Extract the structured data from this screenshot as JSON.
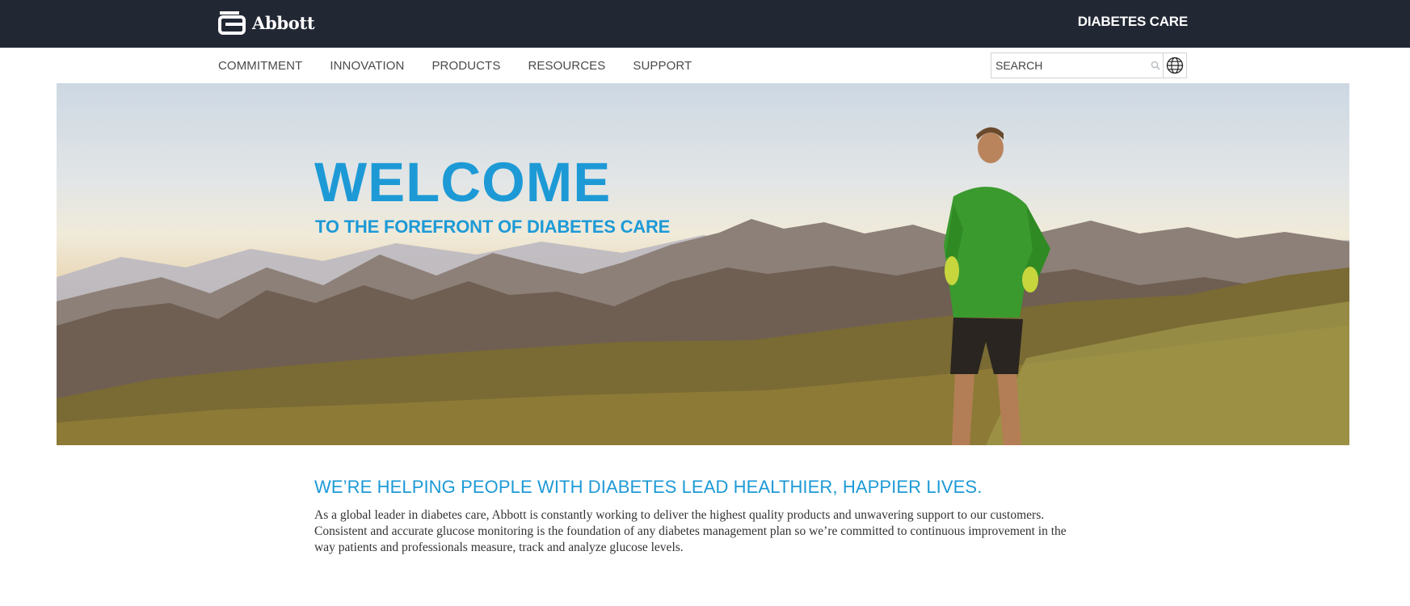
{
  "header": {
    "logo_text": "Abbott",
    "brand_title": "DIABETES CARE"
  },
  "nav": {
    "items": [
      "COMMITMENT",
      "INNOVATION",
      "PRODUCTS",
      "RESOURCES",
      "SUPPORT"
    ]
  },
  "search": {
    "placeholder": "SEARCH",
    "icon": "search-icon"
  },
  "language": {
    "icon": "globe-icon"
  },
  "hero": {
    "title": "WELCOME",
    "subtitle": "TO THE FOREFRONT OF DIABETES CARE"
  },
  "intro": {
    "heading": "WE’RE HELPING PEOPLE WITH DIABETES LEAD HEALTHIER, HAPPIER LIVES.",
    "body": "As a global leader in diabetes care, Abbott is constantly working to deliver the highest quality products and unwavering support to our customers. Consistent and accurate glucose monitoring is the foundation of any diabetes management plan so we’re committed to continuous improvement in the way patients and professionals measure, track and analyze glucose levels."
  },
  "colors": {
    "topbar_bg": "#212733",
    "accent_blue": "#1d9ad6",
    "nav_text": "#4a4a4a",
    "runner_shirt": "#3a9a2e"
  }
}
